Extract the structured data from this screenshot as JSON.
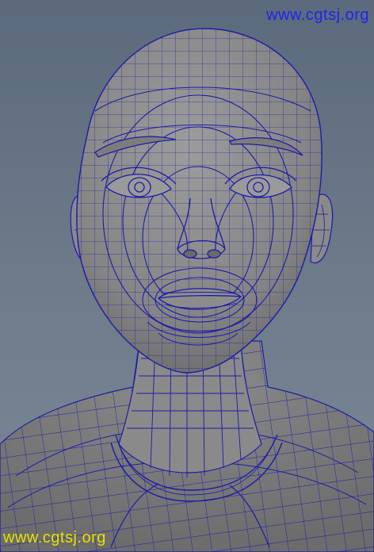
{
  "watermark": {
    "top_text": "www.cgtsj.org",
    "bottom_text": "www.cgtsj.org"
  },
  "colors": {
    "background": "#6d7c8c",
    "mesh_surface": "#8e8e8e",
    "wire": "#1c1ca8",
    "watermark_top": "#2222ee",
    "watermark_bottom": "#e8e000"
  },
  "scene": {
    "subject": "wireframe-head-model"
  }
}
